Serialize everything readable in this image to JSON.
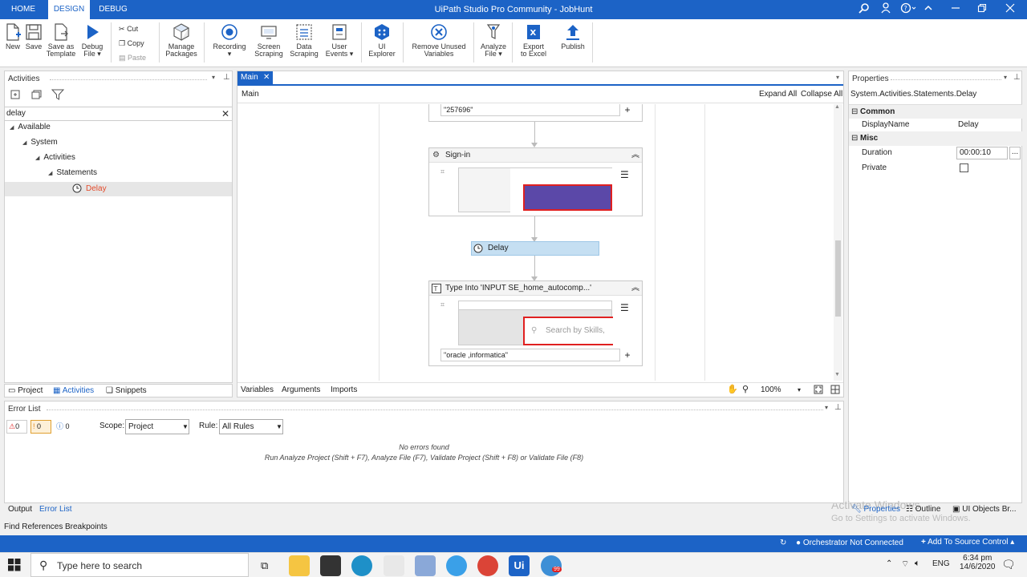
{
  "titlebar": {
    "tabs": [
      {
        "label": "HOME"
      },
      {
        "label": "DESIGN"
      },
      {
        "label": "DEBUG"
      }
    ],
    "title": "UiPath Studio Pro Community - JobHunt"
  },
  "ribbon": {
    "new": "New",
    "save": "Save",
    "save_as_template_1": "Save as",
    "save_as_template_2": "Template",
    "debug_1": "Debug",
    "debug_2": "File",
    "cut": "Cut",
    "copy": "Copy",
    "paste": "Paste",
    "manage_1": "Manage",
    "manage_2": "Packages",
    "recording": "Recording",
    "screen_1": "Screen",
    "screen_2": "Scraping",
    "data_1": "Data",
    "data_2": "Scraping",
    "user_1": "User",
    "user_2": "Events",
    "ui_1": "UI",
    "ui_2": "Explorer",
    "remove_1": "Remove Unused",
    "remove_2": "Variables",
    "analyze_1": "Analyze",
    "analyze_2": "File",
    "export_1": "Export",
    "export_2": "to Excel",
    "publish": "Publish"
  },
  "activities": {
    "title": "Activities",
    "search_value": "delay",
    "tree": [
      {
        "label": "Available"
      },
      {
        "label": "System"
      },
      {
        "label": "Activities"
      },
      {
        "label": "Statements"
      },
      {
        "label": "Delay"
      }
    ],
    "bottom_tabs": [
      {
        "label": "Project"
      },
      {
        "label": "Activities"
      },
      {
        "label": "Snippets"
      }
    ]
  },
  "designer": {
    "tab": "Main",
    "breadcrumb": "Main",
    "expand_all": "Expand All",
    "collapse_all": "Collapse All",
    "top_input_value": "\"257696\"",
    "signin_title": "Sign-in",
    "delay_title": "Delay",
    "typeinto_title": "Type Into 'INPUT  SE_home_autocomp...'",
    "search_placeholder": "Search by Skills,",
    "typeinto_value": "\"oracle ,informatica\"",
    "bottom_tabs": [
      {
        "label": "Variables"
      },
      {
        "label": "Arguments"
      },
      {
        "label": "Imports"
      }
    ],
    "zoom": "100%"
  },
  "properties": {
    "title": "Properties",
    "type_name": "System.Activities.Statements.Delay",
    "common": "Common",
    "display_name_label": "DisplayName",
    "display_name_value": "Delay",
    "misc": "Misc",
    "duration_label": "Duration",
    "duration_value": "00:00:10",
    "private_label": "Private",
    "bottom_tabs": [
      {
        "label": "Properties"
      },
      {
        "label": "Outline"
      },
      {
        "label": "UI Objects Br..."
      }
    ],
    "watermark_1": "Activate Windows",
    "watermark_2": "Go to Settings to activate Windows."
  },
  "errorlist": {
    "title": "Error List",
    "errors": "0",
    "warnings": "0",
    "infos": "0",
    "scope_label": "Scope:",
    "scope_value": "Project",
    "rule_label": "Rule:",
    "rule_value": "All Rules",
    "no_errors": "No errors found",
    "hint": "Run Analyze Project (Shift + F7), Analyze File (F7), Validate Project (Shift + F8) or Validate File (F8)",
    "tabs": [
      {
        "label": "Output"
      },
      {
        "label": "Error List"
      }
    ],
    "tabs2": [
      {
        "label": "Find References"
      },
      {
        "label": "Breakpoints"
      }
    ]
  },
  "statusbar": {
    "orchestrator": "Orchestrator Not Connected",
    "source_control": "Add To Source Control"
  },
  "taskbar": {
    "search_placeholder": "Type here to search",
    "lang": "ENG",
    "time": "6:34 pm",
    "date": "14/6/2020",
    "notification_badge": "99"
  },
  "colors": {
    "accent": "#1c63c6",
    "delay_highlight": "#c5dff2",
    "error_red": "#e44b2b",
    "sign_in_block": "#5b48a8"
  }
}
